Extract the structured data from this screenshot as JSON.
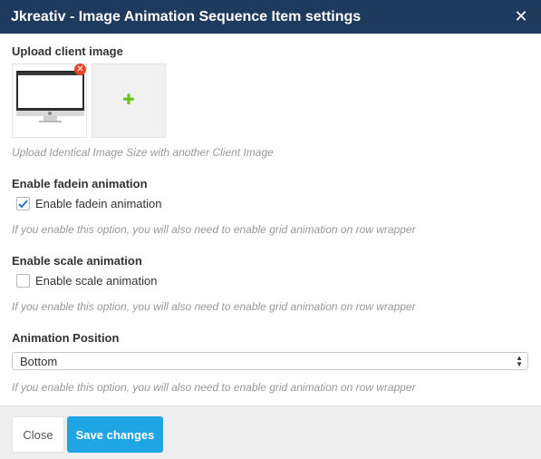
{
  "header": {
    "title": "Jkreativ - Image Animation Sequence Item settings",
    "close_icon": "close-icon",
    "background": "#1e3a5c"
  },
  "upload": {
    "label": "Upload client image",
    "help": "Upload Identical Image Size with another Client Image",
    "remove_icon": "remove-icon",
    "add_icon": "plus-icon"
  },
  "fadein": {
    "label": "Enable fadein animation",
    "checkbox_label": "Enable fadein animation",
    "checked": true,
    "help": "If you enable this option, you will also need to enable grid animation on row wrapper"
  },
  "scale": {
    "label": "Enable scale animation",
    "checkbox_label": "Enable scale animation",
    "checked": false,
    "help": "If you enable this option, you will also need to enable grid animation on row wrapper"
  },
  "position": {
    "label": "Animation Position",
    "selected": "Bottom",
    "help": "If you enable this option, you will also need to enable grid animation on row wrapper"
  },
  "footer": {
    "close_label": "Close",
    "save_label": "Save changes",
    "save_color": "#1fa5e3"
  }
}
